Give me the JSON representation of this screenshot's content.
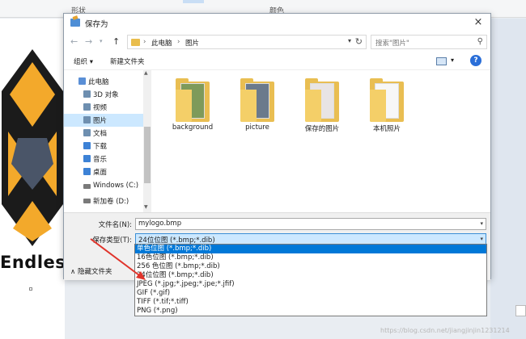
{
  "background": {
    "ribbon_group_shape": "形状",
    "ribbon_group_color": "颜色",
    "canvas_logo_text": "Endles",
    "watermark": "https://blog.csdn.net/jiangjinjin1231214"
  },
  "dialog": {
    "title": "保存为",
    "close_icon": "×",
    "address": {
      "crumbs": [
        "此电脑",
        "图片"
      ],
      "separator": "›"
    },
    "search_placeholder": "搜索\"图片\"",
    "toolbar": {
      "organize": "组织 ▾",
      "new_folder": "新建文件夹"
    },
    "nav_items": [
      {
        "label": "此电脑",
        "icon": "computer-icon",
        "color": "#5a8fd6"
      },
      {
        "label": "3D 对象",
        "icon": "3d-objects-icon",
        "color": "#6e8fb0"
      },
      {
        "label": "视频",
        "icon": "video-icon",
        "color": "#6e8fb0"
      },
      {
        "label": "图片",
        "icon": "pictures-icon",
        "color": "#6e8fb0",
        "selected": true
      },
      {
        "label": "文档",
        "icon": "documents-icon",
        "color": "#6e8fb0"
      },
      {
        "label": "下载",
        "icon": "downloads-icon",
        "color": "#3d82d6"
      },
      {
        "label": "音乐",
        "icon": "music-icon",
        "color": "#3d82d6"
      },
      {
        "label": "桌面",
        "icon": "desktop-icon",
        "color": "#3d82d6"
      },
      {
        "label": "Windows (C:)",
        "icon": "drive-icon",
        "color": "#7a7a7a"
      },
      {
        "label": "新加卷 (D:)",
        "icon": "drive-icon",
        "color": "#7a7a7a"
      }
    ],
    "files": [
      {
        "name": "background"
      },
      {
        "name": "picture"
      },
      {
        "name": "保存的图片"
      },
      {
        "name": "本机照片"
      }
    ],
    "filename_label": "文件名(N):",
    "filename_value": "mylogo.bmp",
    "filetype_label": "保存类型(T):",
    "filetype_value": "24位位图 (*.bmp;*.dib)",
    "hide_folders": "隐藏文件夹",
    "type_options": [
      {
        "label": "单色位图 (*.bmp;*.dib)",
        "selected": true
      },
      {
        "label": "16色位图 (*.bmp;*.dib)"
      },
      {
        "label": "256 色位图 (*.bmp;*.dib)"
      },
      {
        "label": "24位位图 (*.bmp;*.dib)"
      },
      {
        "label": "JPEG (*.jpg;*.jpeg;*.jpe;*.jfif)"
      },
      {
        "label": "GIF (*.gif)"
      },
      {
        "label": "TIFF (*.tif;*.tiff)"
      },
      {
        "label": "PNG (*.png)"
      }
    ],
    "accent_color": "#0078d7"
  }
}
